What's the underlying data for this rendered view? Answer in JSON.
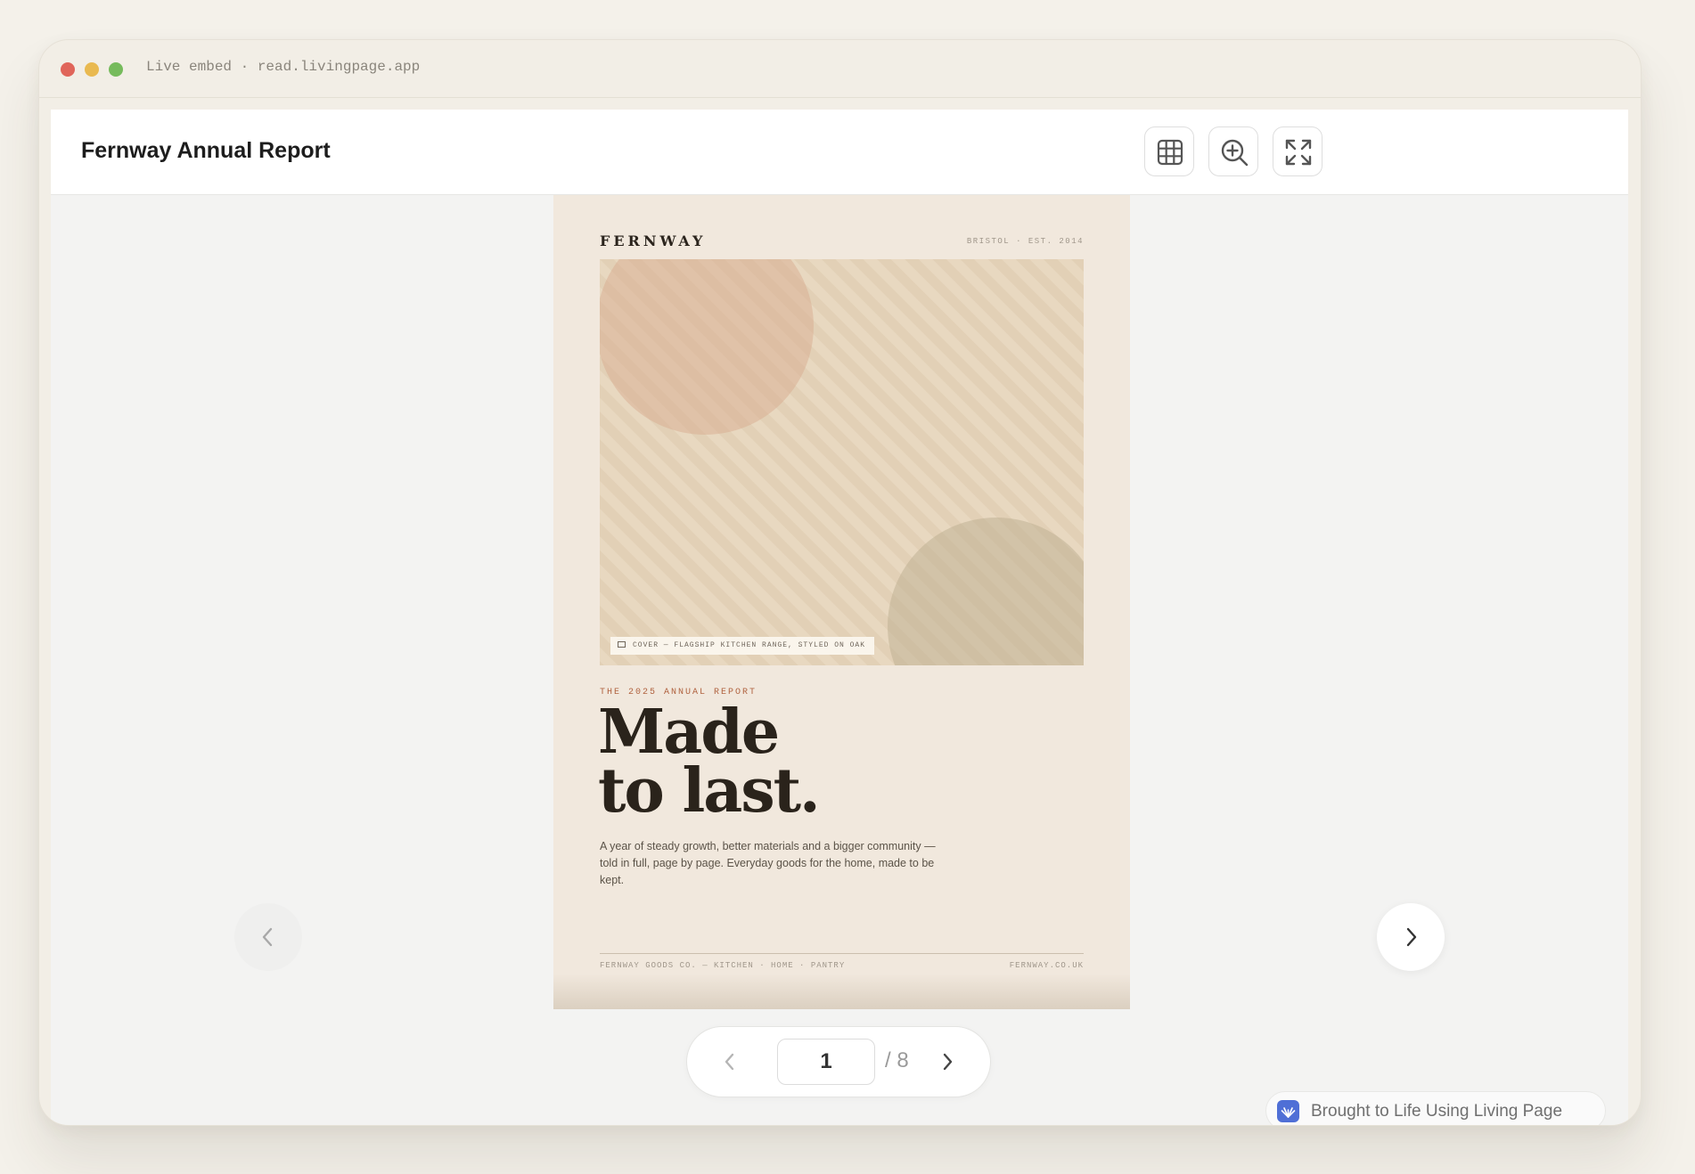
{
  "window": {
    "url_label": "Live embed · read.livingpage.app"
  },
  "viewer": {
    "title": "Fernway Annual Report",
    "toolbar": {
      "grid_icon": "grid-icon",
      "zoom_icon": "zoom-in-icon",
      "fullscreen_icon": "expand-icon"
    }
  },
  "page": {
    "brand": "FERNWAY",
    "meta": "BRISTOL · EST. 2014",
    "cover_caption": "COVER — FLAGSHIP KITCHEN RANGE, STYLED ON OAK",
    "kicker": "THE 2025 ANNUAL REPORT",
    "headline_line1": "Made",
    "headline_line2": "to last.",
    "blurb": "A year of steady growth, better materials and a bigger community — told in full, page by page. Everyday goods for the home, made to be kept.",
    "footer_left": "FERNWAY GOODS CO. — KITCHEN · HOME · PANTRY",
    "footer_right": "FERNWAY.CO.UK"
  },
  "pager": {
    "current": "1",
    "total": "/ 8"
  },
  "badge": {
    "label": "Brought to Life Using Living Page"
  },
  "colors": {
    "accent_kicker": "#b0623f",
    "badge_logo": "#4f6fd6",
    "page_bg": "#f1e8dd"
  }
}
